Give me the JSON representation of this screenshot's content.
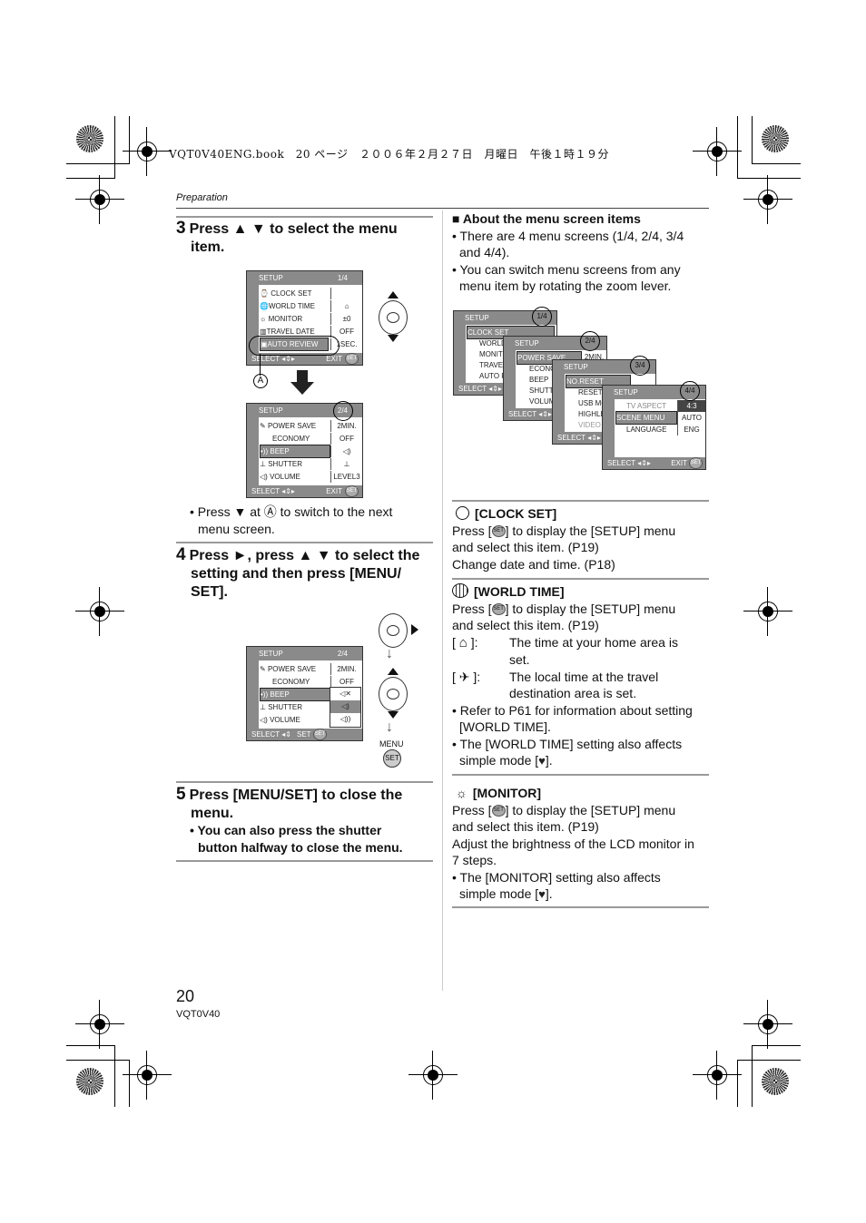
{
  "header": {
    "book_line": "VQT0V40ENG.book　20 ページ　２００６年２月２７日　月曜日　午後１時１９分",
    "section": "Preparation"
  },
  "step3": {
    "num": "3",
    "title_line1": "Press ▲ ▼ to select the menu",
    "title_line2": "item.",
    "note_line1": "• Press ▼ at Ⓐ to switch to the next",
    "note_line2": "menu screen.",
    "callout": "A"
  },
  "screen1": {
    "title": "SETUP",
    "page": "1/4",
    "items": [
      {
        "icon": "⌚",
        "label": "CLOCK SET",
        "value": ""
      },
      {
        "icon": "🌐",
        "label": "WORLD TIME",
        "value": "⌂"
      },
      {
        "icon": "☼",
        "label": "MONITOR",
        "value": "±0"
      },
      {
        "icon": "▥",
        "label": "TRAVEL DATE",
        "value": "OFF"
      },
      {
        "icon": "▣",
        "label": "AUTO REVIEW",
        "value": "1SEC."
      }
    ],
    "footer_left": "SELECT ◂⇕▸",
    "footer_right": "EXIT"
  },
  "screen2": {
    "title": "SETUP",
    "page": "2/4",
    "items": [
      {
        "icon": "✎",
        "label": "POWER SAVE",
        "value": "2MIN."
      },
      {
        "icon": "",
        "label": "ECONOMY",
        "value": "OFF"
      },
      {
        "icon": "•))",
        "label": "BEEP",
        "value": "◁)"
      },
      {
        "icon": "⊥",
        "label": "SHUTTER",
        "value": "⊥"
      },
      {
        "icon": "◁)",
        "label": "VOLUME",
        "value": "LEVEL3"
      }
    ],
    "footer_left": "SELECT ◂⇕▸",
    "footer_right": "EXIT"
  },
  "step4": {
    "num": "4",
    "title_line1": "Press ►, press ▲ ▼ to select the",
    "title_line2": "setting and then press [MENU/",
    "title_line3": "SET]."
  },
  "screen3": {
    "title": "SETUP",
    "page": "2/4",
    "items": [
      {
        "icon": "✎",
        "label": "POWER SAVE",
        "value": "2MIN."
      },
      {
        "icon": "",
        "label": "ECONOMY",
        "value": "OFF"
      },
      {
        "icon": "•))",
        "label": "BEEP",
        "value": ""
      },
      {
        "icon": "⊥",
        "label": "SHUTTER",
        "value": ""
      },
      {
        "icon": "◁)",
        "label": "VOLUME",
        "value": ""
      }
    ],
    "options": [
      "◁✕",
      "◁)",
      "◁))"
    ],
    "footer_left": "SELECT ◂⇕",
    "footer_right": "SET"
  },
  "menu_button": {
    "top": "MENU",
    "label": "SET"
  },
  "step5": {
    "num": "5",
    "title_line1": "Press [MENU/SET] to close the",
    "title_line2": "menu.",
    "note_line1": "• You can also press the shutter",
    "note_line2": "button halfway to close the menu."
  },
  "about": {
    "title": "■ About the menu screen items",
    "bullet1_line1": "• There are 4 menu screens (1/4, 2/4, 3/4",
    "bullet1_line2": "and 4/4).",
    "bullet2_line1": "• You can switch menu screens from any",
    "bullet2_line2": "menu item by rotating the zoom lever."
  },
  "stack": {
    "s1": {
      "title": "SETUP",
      "page": "1/4",
      "items": [
        "CLOCK SET",
        "WORLD",
        "MONITO",
        "TRAVEL",
        "AUTO R"
      ],
      "footer": "SELECT ◂⇕▸"
    },
    "s2": {
      "title": "SETUP",
      "page": "2/4",
      "items": [
        "POWER SAVE",
        "ECONO",
        "BEEP",
        "SHUTTE",
        "VOLUM"
      ],
      "value0": "2MIN.",
      "footer": "SELECT ◂⇕▸"
    },
    "s3": {
      "title": "SETUP",
      "page": "3/4",
      "items": [
        "NO.RESET",
        "RESET",
        "USB MO",
        "HIGHLIG",
        "VIDEO O"
      ],
      "footer": "SELECT ◂⇕▸"
    },
    "s4": {
      "title": "SETUP",
      "page": "4/4",
      "items": [
        "TV ASPECT",
        "SCENE MENU",
        "LANGUAGE"
      ],
      "values": [
        "4:3",
        "AUTO",
        "ENG"
      ],
      "footer_left": "SELECT ◂⇕▸",
      "footer_right": "EXIT"
    }
  },
  "clock_set": {
    "title": "[CLOCK SET]",
    "line1_pre": "Press [",
    "line1_post": "] to display the [SETUP] menu",
    "line2": "and select this item. (P19)",
    "line3": "Change date and time. (P18)"
  },
  "world_time": {
    "title": "[WORLD TIME]",
    "line1_pre": "Press [",
    "line1_post": "] to display the [SETUP] menu",
    "line2": "and select this item. (P19)",
    "home_desc1": "The time at your home area is",
    "home_desc2": "set.",
    "travel_desc1": "The local time at the travel",
    "travel_desc2": "destination area is set.",
    "bullet1_line1": "• Refer to P61 for information about setting",
    "bullet1_line2": "[WORLD TIME].",
    "bullet2_line1": "• The [WORLD TIME] setting also affects",
    "bullet2_line2_pre": "simple mode [",
    "bullet2_line2_post": "]."
  },
  "monitor": {
    "title": "[MONITOR]",
    "line1_pre": "Press [",
    "line1_post": "] to display the [SETUP] menu",
    "line2": "and select this item. (P19)",
    "line3": "Adjust the brightness of the LCD monitor in",
    "line4": "7 steps.",
    "bullet_line1": "• The [MONITOR] setting also affects",
    "bullet_line2_pre": "simple mode [",
    "bullet_line2_post": "]."
  },
  "set_icon": {
    "top": "MENU",
    "label": "SET"
  },
  "footer": {
    "page_number": "20",
    "code": "VQT0V40"
  }
}
